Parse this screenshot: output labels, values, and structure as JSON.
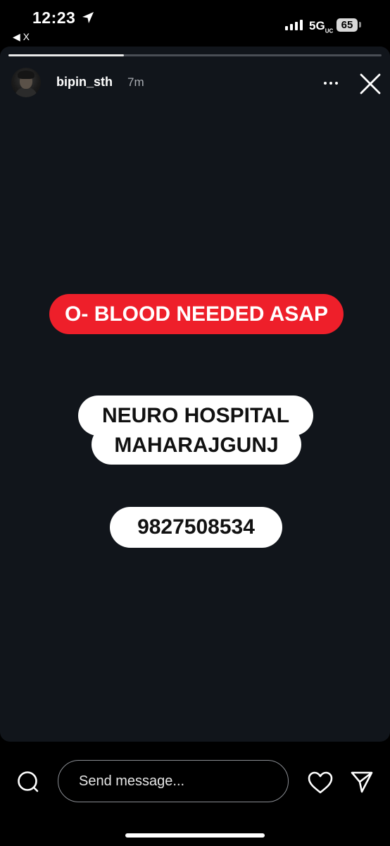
{
  "status_bar": {
    "time": "12:23",
    "back_app_label": "◀ X",
    "network": "5G",
    "network_suffix": "UC",
    "battery": "65",
    "icons": [
      "location-arrow-icon",
      "signal-bars-icon",
      "battery-icon"
    ]
  },
  "story": {
    "progress": 0.31,
    "username": "bipin_sth",
    "posted_ago": "7m",
    "header_icons": [
      "more-options-icon",
      "close-icon"
    ],
    "stickers": {
      "alert": "O- BLOOD NEEDED ASAP",
      "hospital_line1": "NEURO HOSPITAL",
      "hospital_line2": "MAHARAJGUNJ",
      "phone": "9827508534"
    },
    "colors": {
      "background": "#11151b",
      "alert_pill": "#ee1f2a",
      "label_pill": "#ffffff"
    }
  },
  "reply_bar": {
    "placeholder": "Send message...",
    "icons": [
      "camera-icon",
      "heart-icon",
      "send-icon"
    ]
  }
}
